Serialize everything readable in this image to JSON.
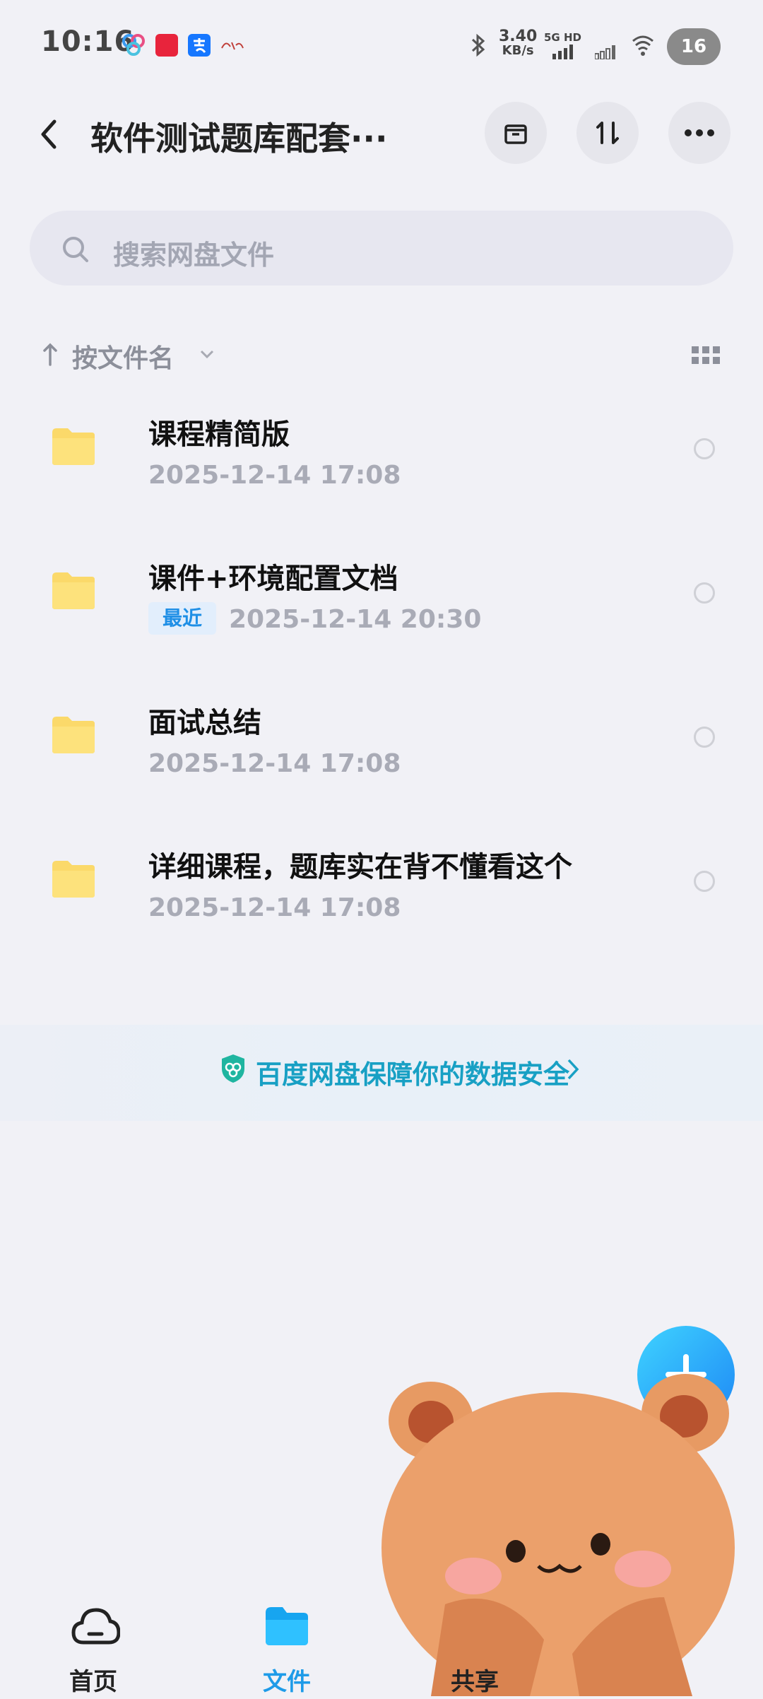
{
  "status_bar": {
    "time": "10:16",
    "net_speed_value": "3.40",
    "net_speed_unit": "KB/s",
    "signal_label": "5G HD",
    "battery": "16"
  },
  "header": {
    "title": "软件测试题库配套···"
  },
  "search": {
    "placeholder": "搜索网盘文件"
  },
  "sort": {
    "label": "按文件名"
  },
  "files": [
    {
      "name": "课程精简版",
      "date": "2025-12-14  17:08",
      "badge": ""
    },
    {
      "name": "课件+环境配置文档",
      "date": "2025-12-14  20:30",
      "badge": "最近"
    },
    {
      "name": "面试总结",
      "date": "2025-12-14  17:08",
      "badge": ""
    },
    {
      "name": "详细课程，题库实在背不懂看这个",
      "date": "2025-12-14  17:08",
      "badge": ""
    }
  ],
  "banner": {
    "text": "百度网盘保障你的数据安全"
  },
  "bottom_nav": {
    "items": [
      {
        "label": "首页",
        "icon": "cloud-icon"
      },
      {
        "label": "文件",
        "icon": "folder-icon"
      },
      {
        "label": "共享",
        "icon": "share-icon"
      }
    ]
  },
  "colors": {
    "accent": "#1e9be8",
    "folder": "#fbd96a",
    "background": "#f1f1f6"
  }
}
